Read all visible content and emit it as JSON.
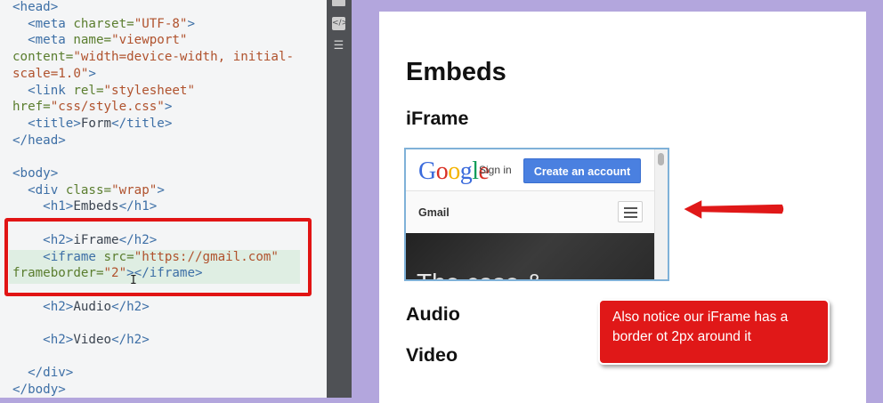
{
  "editor": {
    "lines": [
      {
        "tag": "<head>"
      },
      {
        "indent": "  ",
        "tag": "<meta ",
        "attr": "charset=",
        "str": "\"UTF-8\"",
        "tag2": ">"
      },
      {
        "indent": "  ",
        "tag": "<meta ",
        "attr": "name=",
        "str": "\"viewport\""
      },
      {
        "attr": "content=",
        "str": "\"width=device-width, initial-"
      },
      {
        "str": "scale=1.0\"",
        "tag2": ">"
      },
      {
        "indent": "  ",
        "tag": "<link ",
        "attr": "rel=",
        "str": "\"stylesheet\""
      },
      {
        "attr": "href=",
        "str": "\"css/style.css\"",
        "tag2": ">"
      },
      {
        "indent": "  ",
        "tag": "<title>",
        "txt": "Form",
        "tag2": "</title>"
      },
      {
        "tag": "</head>"
      },
      {},
      {
        "tag": "<body>"
      },
      {
        "indent": "  ",
        "tag": "<div ",
        "attr": "class=",
        "str": "\"wrap\"",
        "tag2": ">"
      },
      {
        "indent": "    ",
        "tag": "<h1>",
        "txt": "Embeds",
        "tag2": "</h1>"
      },
      {},
      {
        "indent": "    ",
        "tag": "<h2>",
        "txt": "iFrame",
        "tag2": "</h2>"
      },
      {
        "indent": "    ",
        "tag": "<iframe ",
        "attr": "src=",
        "str": "\"https://gmail.com\""
      },
      {
        "attr": "frameborder=",
        "str": "\"2\"",
        "tag2": "></iframe>"
      },
      {},
      {
        "indent": "    ",
        "tag": "<h2>",
        "txt": "Audio",
        "tag2": "</h2>"
      },
      {},
      {
        "indent": "    ",
        "tag": "<h2>",
        "txt": "Video",
        "tag2": "</h2>"
      },
      {},
      {
        "indent": "  ",
        "tag": "</div>"
      },
      {
        "tag": "</body>"
      }
    ]
  },
  "gutter": {
    "icons": [
      "square-icon",
      "code-icon",
      "layers-icon"
    ]
  },
  "preview": {
    "h1": "Embeds",
    "h2_iframe": "iFrame",
    "h2_audio": "Audio",
    "h2_video": "Video",
    "iframe": {
      "logo": "Google",
      "signin": "Sign in",
      "create_button": "Create an account",
      "gmail_label": "Gmail",
      "hero_text": "The case &"
    }
  },
  "annotation": {
    "callout_text": "Also notice our iFrame has a border ot 2px around it",
    "arrow_color": "#e01818"
  }
}
